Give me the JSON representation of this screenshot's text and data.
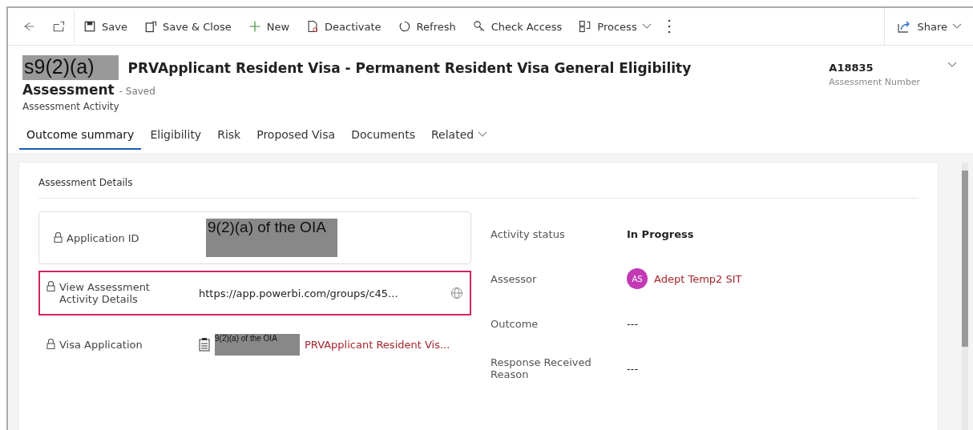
{
  "toolbar": {
    "items": [
      {
        "kind": "back"
      },
      {
        "kind": "popout"
      },
      {
        "kind": "save",
        "label": "Save"
      },
      {
        "kind": "saveclose",
        "label": "Save & Close"
      },
      {
        "kind": "new",
        "label": "New"
      },
      {
        "kind": "deactivate",
        "label": "Deactivate"
      },
      {
        "kind": "refresh",
        "label": "Refresh"
      },
      {
        "kind": "key",
        "label": "Check Access"
      },
      {
        "kind": "process",
        "label": "Process"
      },
      {
        "kind": "more"
      }
    ],
    "share": "Share"
  },
  "header": {
    "redaction": "s9(2)(a)",
    "title": "PRVApplicant Resident Visa - Permanent Resident Visa General Eligibility",
    "title_line2": "Assessment",
    "status": "- Saved",
    "entity": "Assessment Activity",
    "number": "A18835",
    "number_label": "Assessment Number"
  },
  "tabs": [
    {
      "label": "Outcome summary",
      "selected": true
    },
    {
      "label": "Eligibility",
      "selected": false
    },
    {
      "label": "Risk",
      "selected": false
    },
    {
      "label": "Proposed Visa",
      "selected": false
    },
    {
      "label": "Documents",
      "selected": false
    },
    {
      "label": "Related",
      "selected": false
    }
  ],
  "section": {
    "title": "Assessment Details",
    "left_fields": [
      {
        "kind": "redacted",
        "label": "Application ID",
        "redaction": "9(2)(a) of the OIA",
        "highlighted": false,
        "boxed": true
      },
      {
        "kind": "url",
        "label": "View Assessment Activity Details",
        "value": "https://app.powerbi.com/groups/c45...",
        "highlighted": true,
        "boxed": false
      },
      {
        "kind": "lookup",
        "label": "Visa Application",
        "redaction": "9(2)(a) of the OIA",
        "value": "PRVApplicant Resident Vis..."
      }
    ],
    "right_fields": [
      {
        "kind": "bold",
        "label": "Activity status",
        "value": "In Progress"
      },
      {
        "kind": "person",
        "label": "Assessor",
        "initials": "AS",
        "value": "Adept Temp2 SIT",
        "color": "#c239b3"
      },
      {
        "kind": "plain",
        "label": "Outcome",
        "value": "---"
      },
      {
        "kind": "plain",
        "label": "Response Received Reason",
        "value": "---"
      }
    ]
  }
}
